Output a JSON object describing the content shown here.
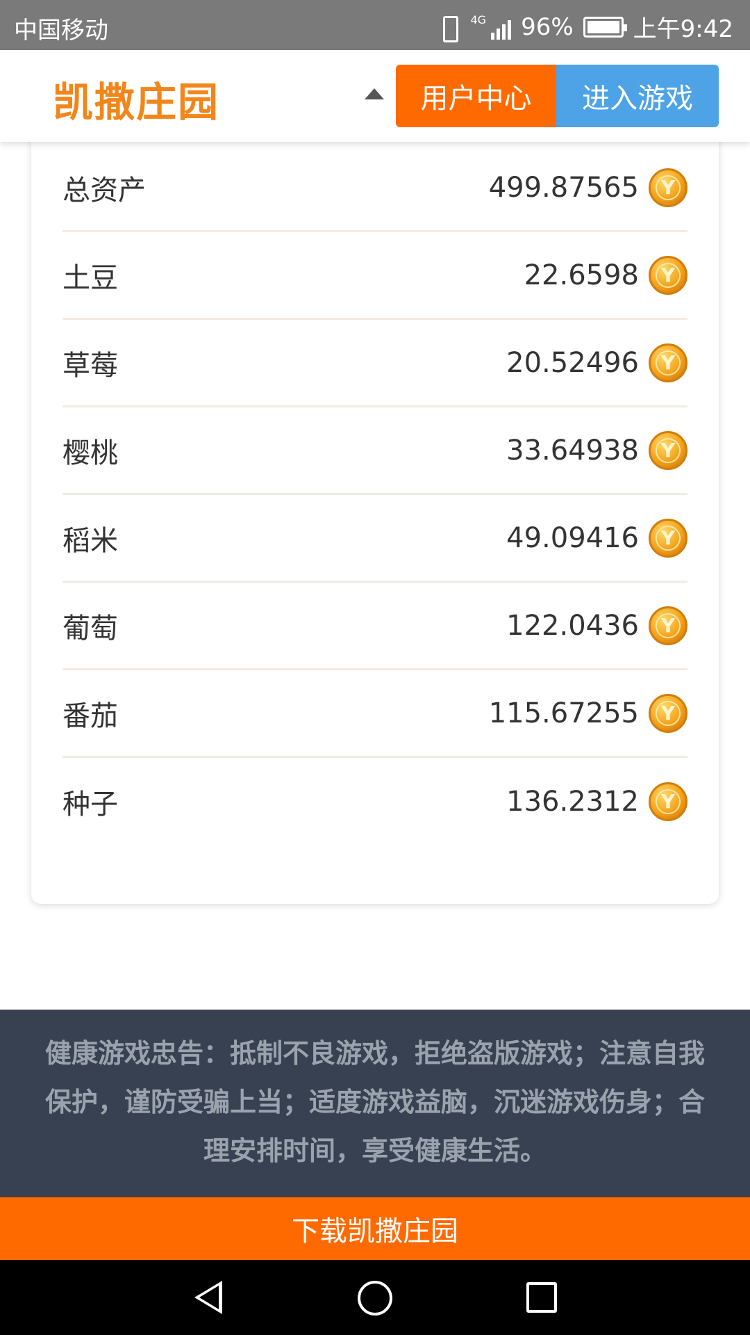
{
  "status_bar": {
    "carrier": "中国移动",
    "network": "4G",
    "battery": "96%",
    "time": "上午9:42"
  },
  "header": {
    "logo": "凯撒庄园",
    "user_center": "用户中心",
    "enter_game": "进入游戏"
  },
  "assets": [
    {
      "label": "总资产",
      "value": "499.87565"
    },
    {
      "label": "土豆",
      "value": "22.6598"
    },
    {
      "label": "草莓",
      "value": "20.52496"
    },
    {
      "label": "樱桃",
      "value": "33.64938"
    },
    {
      "label": "稻米",
      "value": "49.09416"
    },
    {
      "label": "葡萄",
      "value": "122.0436"
    },
    {
      "label": "番茄",
      "value": "115.67255"
    },
    {
      "label": "种子",
      "value": "136.2312"
    }
  ],
  "notice": "健康游戏忠告：抵制不良游戏，拒绝盗版游戏；注意自我保护，谨防受骗上当；适度游戏益脑，沉迷游戏伤身；合理安排时间，享受健康生活。",
  "download": "下载凯撒庄园",
  "coin_glyph": "Y",
  "colors": {
    "brand_orange": "#ff6a00",
    "logo_orange": "#f2861a",
    "blue": "#4da3e6",
    "footer_bg": "#374151"
  }
}
